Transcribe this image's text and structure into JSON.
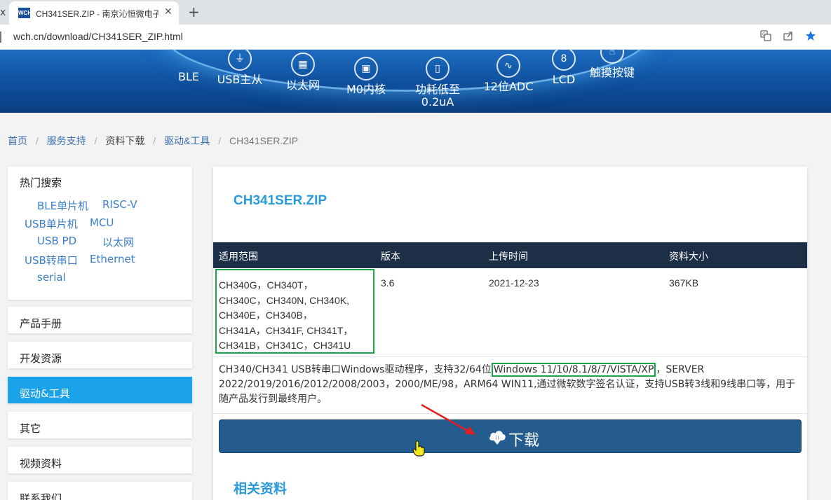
{
  "browser": {
    "tab_fragment": "x",
    "tab": {
      "favicon_text": "WCH",
      "title": "CH341SER.ZIP - 南京沁恒微电子",
      "close": "✕"
    },
    "new_tab": "+",
    "url": "wch.cn/download/CH341SER_ZIP.html",
    "icons": [
      "translate-icon",
      "share-icon",
      "bookmark-star-icon"
    ]
  },
  "banner": {
    "items": [
      {
        "label": "BLE",
        "icon": "bluetooth-icon"
      },
      {
        "label": "USB主从",
        "icon": "usb-icon"
      },
      {
        "label": "以太网",
        "icon": "ethernet-icon"
      },
      {
        "label": "M0内核",
        "icon": "chip-icon"
      },
      {
        "label1": "功耗低至",
        "label2": "0.2uA",
        "icon": "battery-icon"
      },
      {
        "label": "12位ADC",
        "icon": "adc-wave-icon"
      },
      {
        "label": "LCD",
        "icon": "lcd-digit-icon"
      },
      {
        "label": "触摸按键",
        "icon": "touch-icon"
      }
    ]
  },
  "breadcrumb": {
    "home": "首页",
    "service": "服务支持",
    "download": "资料下载",
    "drivers": "驱动&工具",
    "current": "CH341SER.ZIP",
    "separator": "/"
  },
  "sidebar": {
    "hot_title": "热门搜索",
    "hot_links": [
      "BLE单片机",
      "RISC-V",
      "USB单片机",
      "MCU",
      "USB PD",
      "以太网",
      "USB转串口",
      "Ethernet",
      "serial"
    ],
    "items": [
      "产品手册",
      "开发资源",
      "驱动&工具",
      "其它",
      "视频资料",
      "联系我们"
    ],
    "active_index": 2
  },
  "main": {
    "title": "CH341SER.ZIP",
    "table": {
      "headers": [
        "适用范围",
        "版本",
        "上传时间",
        "资料大小"
      ],
      "scope_lines": [
        "CH340G，CH340T，",
        "CH340C，CH340N, CH340K,",
        "CH340E，CH340B，",
        "CH341A，CH341F, CH341T，",
        "CH341B，CH341C，CH341U"
      ],
      "version": "3.6",
      "upload_date": "2021-12-23",
      "size": "367KB"
    },
    "description": {
      "before": "CH340/CH341 USB转串口Windows驱动程序，支持32/64位",
      "highlight": "Windows 11/10/8.1/8/7/VISTA/XP",
      "after": "，SERVER 2022/2019/2016/2012/2008/2003，2000/ME/98，ARM64 WIN11,通过微软数字签名认证，支持USB转3线和9线串口等，用于随产品发行到最终用户。"
    },
    "download_label": "下载",
    "related_title": "相关资料"
  },
  "colors": {
    "accent": "#2a9ad9",
    "active_sidebar": "#1aa3e8",
    "table_header": "#1d2f47",
    "download_button": "#255c8f",
    "highlight_box": "#1aa547",
    "annotation_arrow": "#e02020"
  }
}
